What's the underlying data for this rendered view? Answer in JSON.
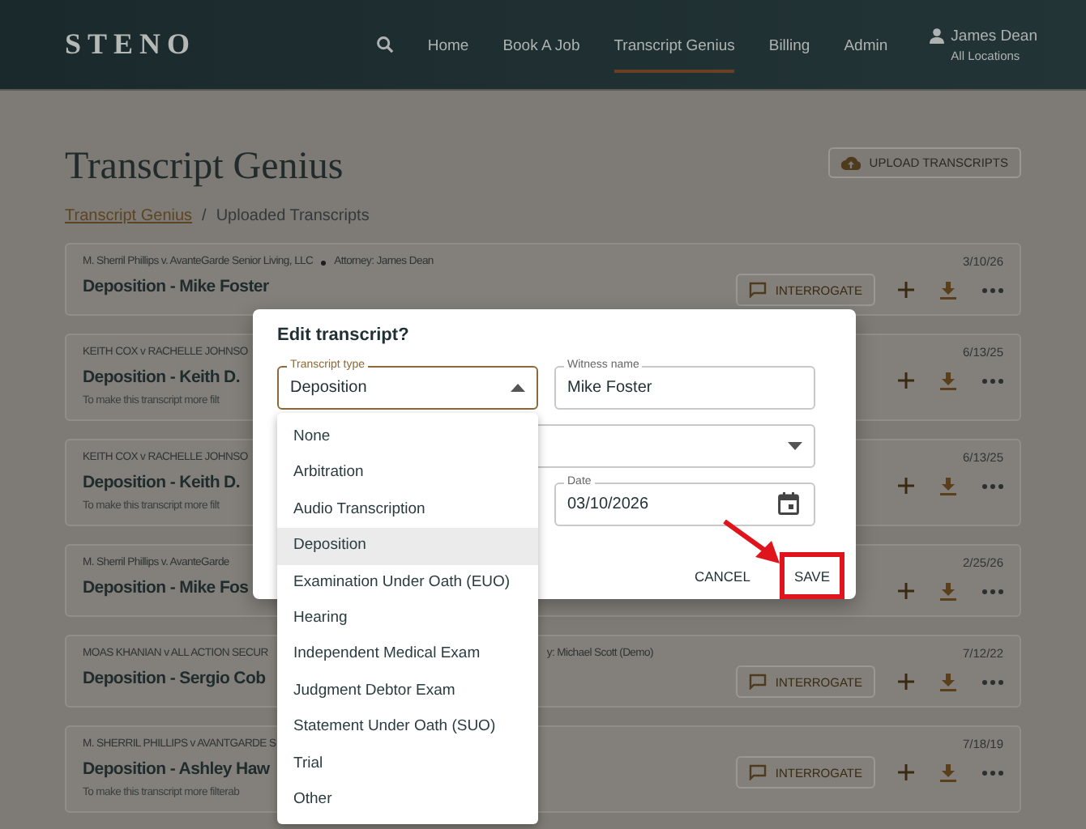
{
  "header": {
    "logo": "STENO",
    "nav": [
      {
        "label": "Home",
        "selected": false
      },
      {
        "label": "Book A Job",
        "selected": false
      },
      {
        "label": "Transcript Genius",
        "selected": true
      },
      {
        "label": "Billing",
        "selected": false
      },
      {
        "label": "Admin",
        "selected": false
      }
    ],
    "user": {
      "name": "James Dean",
      "location": "All Locations"
    }
  },
  "page": {
    "title": "Transcript Genius",
    "upload_button": "UPLOAD TRANSCRIPTS",
    "breadcrumb": [
      {
        "label": "Transcript Genius",
        "kind": "link"
      },
      {
        "label": "/",
        "kind": "separator"
      },
      {
        "label": "Uploaded Transcripts",
        "kind": "current"
      }
    ]
  },
  "cards": [
    {
      "meta": "M. Sherril Phillips v. AvanteGarde Senior Living, LLC",
      "attorney": "Attorney: James Dean",
      "dot": true,
      "date": "3/10/26",
      "title": "Deposition - Mike Foster",
      "interrogate": "INTERROGATE"
    },
    {
      "meta": "KEITH COX v RACHELLE JOHNSO",
      "date": "6/13/25",
      "title": "Deposition - Keith D.",
      "note": "To make this transcript more filt"
    },
    {
      "meta": "KEITH COX v RACHELLE JOHNSO",
      "date": "6/13/25",
      "title": "Deposition - Keith D.",
      "note": "To make this transcript more filt"
    },
    {
      "meta": "M. Sherril Phillips v. AvanteGarde",
      "date": "2/25/26",
      "title": "Deposition - Mike Fos"
    },
    {
      "meta": "MOAS KHANIAN v ALL ACTION SECUR",
      "attorney": "y: Michael Scott (Demo)",
      "dot": false,
      "date": "7/12/22",
      "title": "Deposition - Sergio Cob",
      "interrogate": "INTERROGATE"
    },
    {
      "meta": "M. SHERRIL PHILLIPS v AVANTGARDE S",
      "date": "7/18/19",
      "title": "Deposition - Ashley Haw",
      "note": "To make this transcript more filterab",
      "interrogate": "INTERROGATE"
    }
  ],
  "dialog": {
    "title": "Edit transcript?",
    "fields": [
      {
        "kind": "select",
        "label": "Transcript type",
        "value": "Deposition",
        "open": true
      },
      {
        "kind": "text",
        "label": "Witness name",
        "value": "Mike Foster"
      },
      {
        "kind": "select"
      },
      {
        "kind": "date",
        "label": "Date",
        "value": "03/10/2026"
      }
    ],
    "buttons": [
      {
        "label": "CANCEL",
        "kind": "cancel"
      },
      {
        "label": "SAVE",
        "kind": "save"
      }
    ],
    "options": [
      {
        "label": "None",
        "selected": false
      },
      {
        "label": "Arbitration",
        "selected": false
      },
      {
        "label": "Audio Transcription",
        "selected": false
      },
      {
        "label": "Deposition",
        "selected": true
      },
      {
        "label": "Examination Under Oath (EUO)",
        "selected": false
      },
      {
        "label": "Hearing",
        "selected": false
      },
      {
        "label": "Independent Medical Exam",
        "selected": false
      },
      {
        "label": "Judgment Debtor Exam",
        "selected": false
      },
      {
        "label": "Statement Under Oath (SUO)",
        "selected": false
      },
      {
        "label": "Trial",
        "selected": false
      },
      {
        "label": "Other",
        "selected": false
      }
    ]
  }
}
